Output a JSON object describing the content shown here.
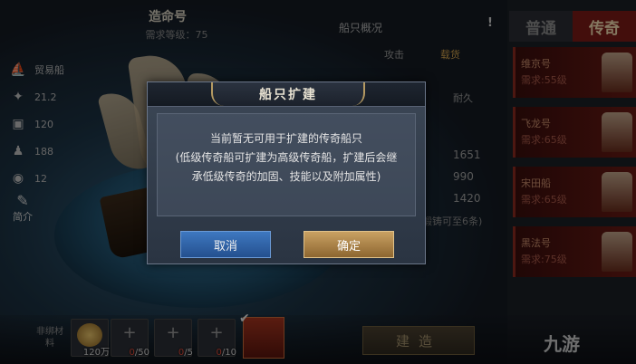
{
  "ship": {
    "name": "造命号",
    "requirement": "需求等级：75"
  },
  "stats": [
    {
      "icon": "ship-icon",
      "glyph": "⛵",
      "value": "贸易船"
    },
    {
      "icon": "cannon-icon",
      "glyph": "✦",
      "value": "21.2"
    },
    {
      "icon": "cargo-icon",
      "glyph": "▣",
      "value": "120"
    },
    {
      "icon": "sailor-icon",
      "glyph": "♟",
      "value": "188"
    },
    {
      "icon": "barrel-icon",
      "glyph": "◉",
      "value": "12"
    }
  ],
  "intro_label": "简介",
  "overview": {
    "title": "船只概况",
    "warn": "!",
    "attack_label": "攻击",
    "cargo_label": "载货",
    "durability_label": "耐久",
    "values": [
      "1651",
      "990",
      "1420"
    ],
    "note": "锻铸可至6条)"
  },
  "tabs": {
    "normal": "普通",
    "legend": "传奇"
  },
  "ships_list": [
    {
      "name": "维京号",
      "req": "需求:55级"
    },
    {
      "name": "飞龙号",
      "req": "需求:65级"
    },
    {
      "name": "宋田船",
      "req": "需求:65级"
    },
    {
      "name": "黑法号",
      "req": "需求:75级"
    }
  ],
  "bottom": {
    "bind_label": "非绑材料",
    "coin_count": "120万",
    "mats": [
      {
        "have": "0",
        "need": "/50"
      },
      {
        "have": "0",
        "need": "/5"
      },
      {
        "have": "0",
        "need": "/10"
      }
    ],
    "build_label": "建造",
    "watermark": "九游"
  },
  "dialog": {
    "title": "船只扩建",
    "line1": "当前暂无可用于扩建的传奇船只",
    "line2": "(低级传奇船可扩建为高级传奇船，扩建后会继",
    "line3": "承低级传奇的加固、技能以及附加属性)",
    "cancel": "取消",
    "confirm": "确定"
  }
}
